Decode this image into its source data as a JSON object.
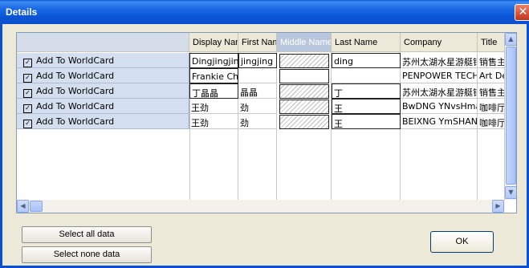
{
  "window": {
    "title": "Details",
    "close_glyph": "✕"
  },
  "grid": {
    "columns": [
      "Display Nam",
      "First Name",
      "Middle Name",
      "Last Name",
      "Company",
      "Title"
    ],
    "row_label": "Add To WorldCard",
    "rows": [
      {
        "display": "Dingjingjing",
        "first": "jingjing",
        "middle": "",
        "last": "ding",
        "company": "苏州太湖水星游艇销",
        "title": "销售主"
      },
      {
        "display": "Frankie Char",
        "first": "",
        "middle": "",
        "last": "",
        "company": "PENPOWER TECHN",
        "title": "Art Des"
      },
      {
        "display": "丁晶晶",
        "first": "晶晶",
        "middle": "",
        "last": "丁",
        "company": "苏州太湖水星游艇销",
        "title": "销售主"
      },
      {
        "display": "王劲",
        "first": "劲",
        "middle": "",
        "last": "王",
        "company": "BwDNG YNvsHma H",
        "title": "咖啡厅"
      },
      {
        "display": "王劲",
        "first": "劲",
        "middle": "",
        "last": "王",
        "company": "BEIXNG YmSHAN H",
        "title": "咖啡厅"
      }
    ]
  },
  "buttons": {
    "select_all": "Select all data",
    "select_none": "Select none data",
    "ok": "OK"
  }
}
